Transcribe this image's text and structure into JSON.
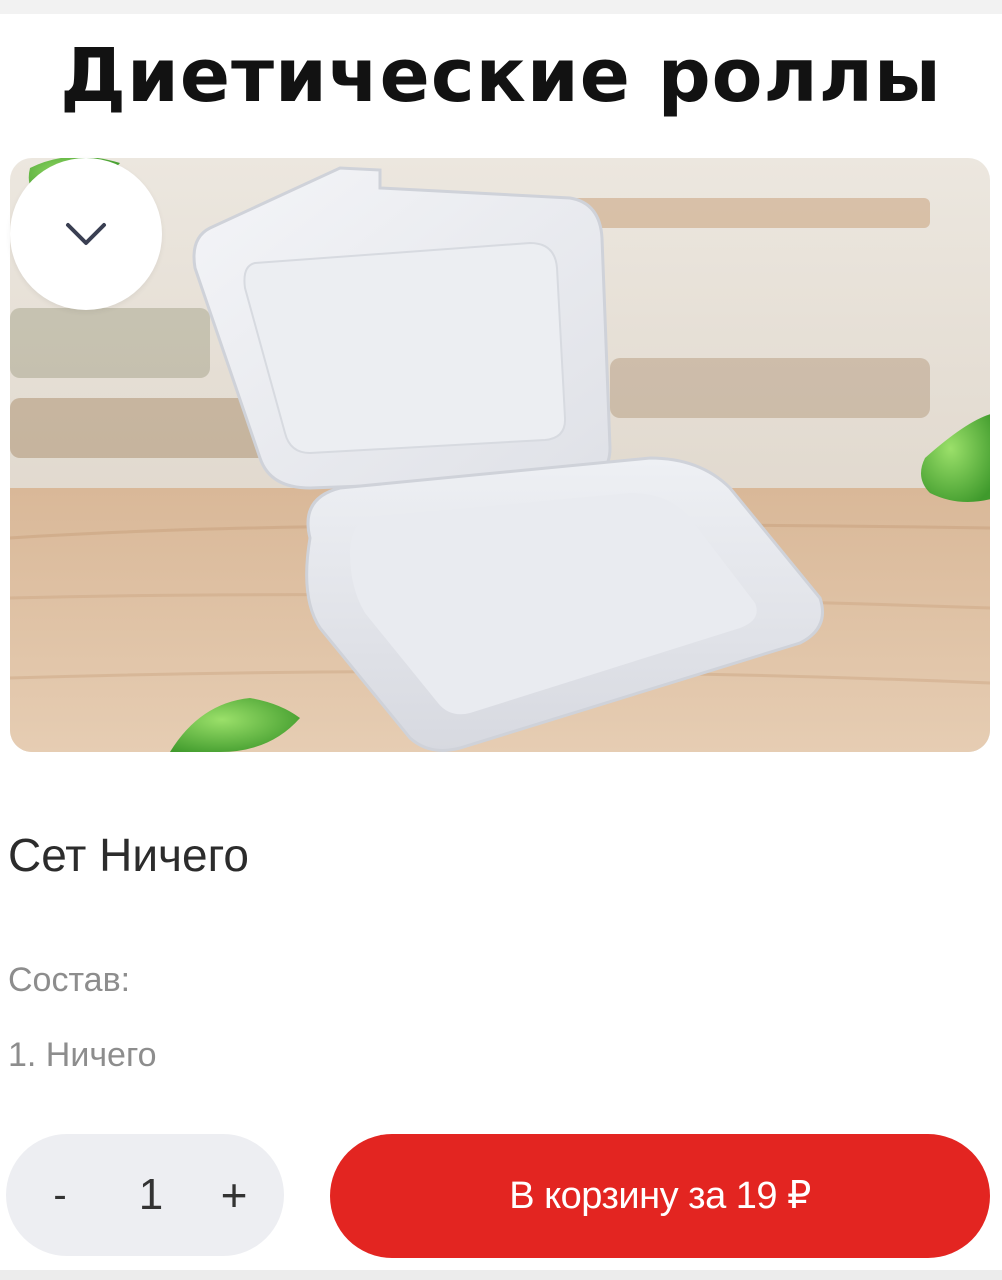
{
  "page": {
    "headline": "Диетические роллы"
  },
  "product": {
    "image_icon": "foam-food-container-image",
    "collapse_icon": "chevron-down-icon",
    "name": "Сет Ничего",
    "composition_label": "Состав:",
    "composition_items": [
      "1. Ничего"
    ]
  },
  "order": {
    "minus_label": "-",
    "quantity": "1",
    "plus_label": "+",
    "cart_button_label": "В корзину за 19 ₽"
  },
  "colors": {
    "accent": "#e32521",
    "stepper_bg": "#edeef2",
    "muted_text": "#8d8d8d"
  }
}
